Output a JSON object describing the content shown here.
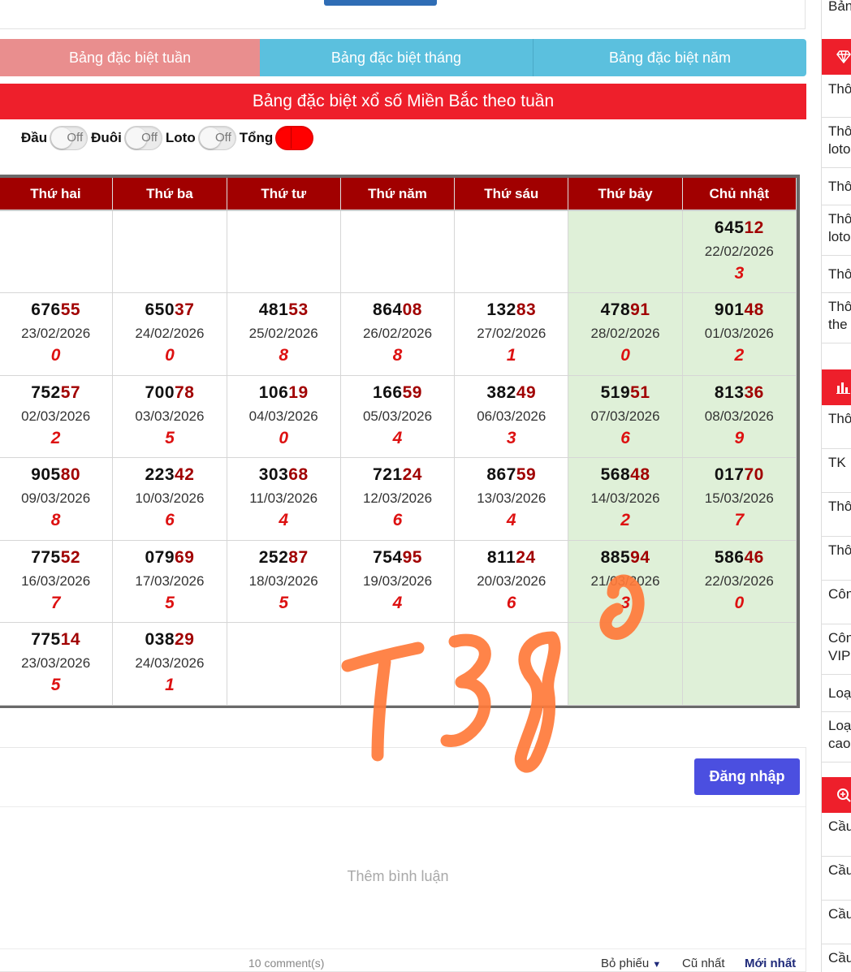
{
  "tabs": [
    {
      "label": "Bảng đặc biệt tuần"
    },
    {
      "label": "Bảng đặc biệt tháng"
    },
    {
      "label": "Bảng đặc biệt năm"
    }
  ],
  "panel_title": "Bảng đặc biệt xổ số Miền Bắc theo tuần",
  "toggles": [
    {
      "label": "Đầu",
      "state": "Off"
    },
    {
      "label": "Đuôi",
      "state": "Off"
    },
    {
      "label": "Loto",
      "state": "Off"
    },
    {
      "label": "Tổng",
      "state": "On"
    }
  ],
  "table": {
    "headers": [
      "Thứ hai",
      "Thứ ba",
      "Thứ tư",
      "Thứ năm",
      "Thứ sáu",
      "Thứ bảy",
      "Chủ nhật"
    ],
    "rows": [
      [
        null,
        null,
        null,
        null,
        null,
        null,
        {
          "head": "645",
          "tail": "12",
          "date": "22/02/2026",
          "sum": "3"
        }
      ],
      [
        {
          "head": "676",
          "tail": "55",
          "date": "23/02/2026",
          "sum": "0"
        },
        {
          "head": "650",
          "tail": "37",
          "date": "24/02/2026",
          "sum": "0"
        },
        {
          "head": "481",
          "tail": "53",
          "date": "25/02/2026",
          "sum": "8"
        },
        {
          "head": "864",
          "tail": "08",
          "date": "26/02/2026",
          "sum": "8"
        },
        {
          "head": "132",
          "tail": "83",
          "date": "27/02/2026",
          "sum": "1"
        },
        {
          "head": "478",
          "tail": "91",
          "date": "28/02/2026",
          "sum": "0"
        },
        {
          "head": "901",
          "tail": "48",
          "date": "01/03/2026",
          "sum": "2"
        }
      ],
      [
        {
          "head": "752",
          "tail": "57",
          "date": "02/03/2026",
          "sum": "2"
        },
        {
          "head": "700",
          "tail": "78",
          "date": "03/03/2026",
          "sum": "5"
        },
        {
          "head": "106",
          "tail": "19",
          "date": "04/03/2026",
          "sum": "0"
        },
        {
          "head": "166",
          "tail": "59",
          "date": "05/03/2026",
          "sum": "4"
        },
        {
          "head": "382",
          "tail": "49",
          "date": "06/03/2026",
          "sum": "3"
        },
        {
          "head": "519",
          "tail": "51",
          "date": "07/03/2026",
          "sum": "6"
        },
        {
          "head": "813",
          "tail": "36",
          "date": "08/03/2026",
          "sum": "9"
        }
      ],
      [
        {
          "head": "905",
          "tail": "80",
          "date": "09/03/2026",
          "sum": "8"
        },
        {
          "head": "223",
          "tail": "42",
          "date": "10/03/2026",
          "sum": "6"
        },
        {
          "head": "303",
          "tail": "68",
          "date": "11/03/2026",
          "sum": "4"
        },
        {
          "head": "721",
          "tail": "24",
          "date": "12/03/2026",
          "sum": "6"
        },
        {
          "head": "867",
          "tail": "59",
          "date": "13/03/2026",
          "sum": "4"
        },
        {
          "head": "568",
          "tail": "48",
          "date": "14/03/2026",
          "sum": "2"
        },
        {
          "head": "017",
          "tail": "70",
          "date": "15/03/2026",
          "sum": "7"
        }
      ],
      [
        {
          "head": "775",
          "tail": "52",
          "date": "16/03/2026",
          "sum": "7"
        },
        {
          "head": "079",
          "tail": "69",
          "date": "17/03/2026",
          "sum": "5"
        },
        {
          "head": "252",
          "tail": "87",
          "date": "18/03/2026",
          "sum": "5"
        },
        {
          "head": "754",
          "tail": "95",
          "date": "19/03/2026",
          "sum": "4"
        },
        {
          "head": "811",
          "tail": "24",
          "date": "20/03/2026",
          "sum": "6"
        },
        {
          "head": "885",
          "tail": "94",
          "date": "21/03/2026",
          "sum": "3"
        },
        {
          "head": "586",
          "tail": "46",
          "date": "22/03/2026",
          "sum": "0"
        }
      ],
      [
        {
          "head": "775",
          "tail": "14",
          "date": "23/03/2026",
          "sum": "5"
        },
        {
          "head": "038",
          "tail": "29",
          "date": "24/03/2026",
          "sum": "1"
        },
        null,
        null,
        null,
        null,
        null
      ]
    ]
  },
  "comments": {
    "login_label": "Đăng nhập",
    "add_placeholder": "Thêm bình luận",
    "count": "10 comment(s)",
    "vote_label": "Bỏ phiếu",
    "oldest_label": "Cũ nhất",
    "newest_label": "Mới nhất"
  },
  "sidebar": {
    "top_item": "Bản",
    "section1_icon": "diamond-icon",
    "section1_items": [
      "Thô",
      "Thô loto",
      "Thô",
      "Thô loto",
      "Thô",
      "Thô the"
    ],
    "section2_icon": "bar-chart-icon",
    "section2_items": [
      "Thô",
      "TK",
      "Thô",
      "Thô",
      "Côn",
      "Côn VIP",
      "Loạ",
      "Loạ cao"
    ],
    "section3_icon": "search-plus-icon",
    "section3_items": [
      "Cầu",
      "Cầu",
      "Cầu",
      "Cầu"
    ]
  },
  "watermark": {
    "text": "T380",
    "color": "#ff7a3a"
  },
  "colors": {
    "header": "#a10000",
    "title": "#ee1f2b",
    "tab_active": "#e98e8e",
    "tab": "#5bc0de",
    "weekend": "#dff0d8",
    "login": "#4b4fe0"
  }
}
